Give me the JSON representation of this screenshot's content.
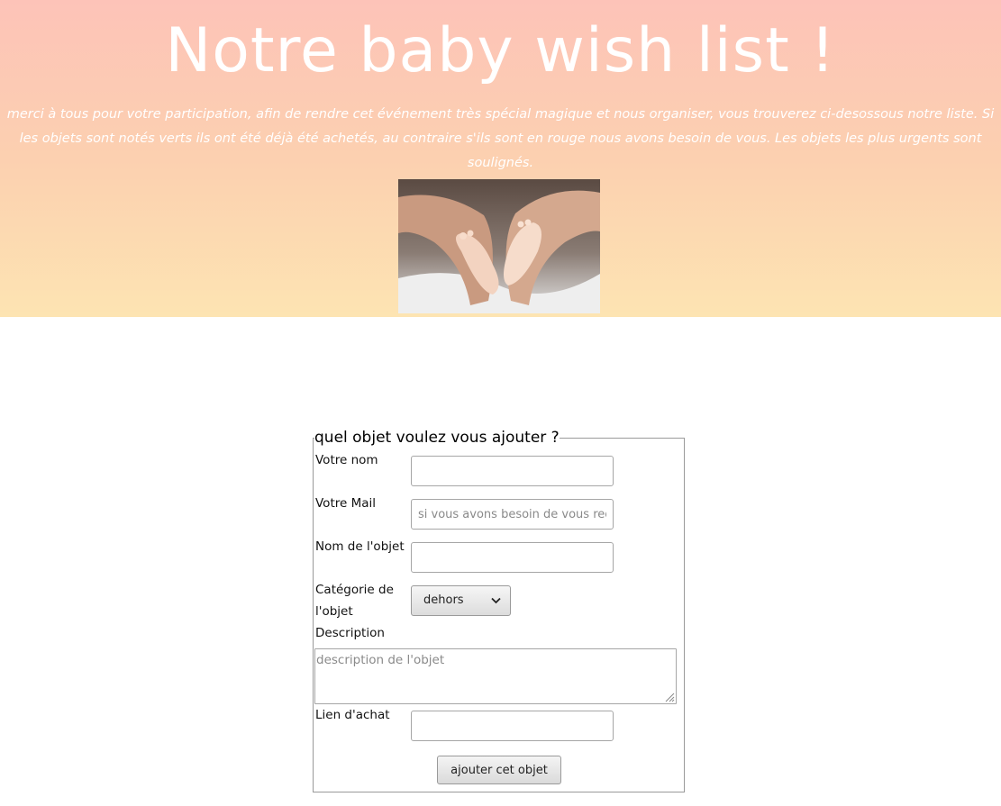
{
  "header": {
    "title": "Notre baby wish list !",
    "subtitle": "merci à tous pour votre participation, afin de rendre cet événement très spécial magique et nous organiser, vous trouverez ci-desossous notre liste. Si les objets sont notés verts ils ont été déjà été achetés, au contraire s'ils sont en rouge nous avons besoin de vous. Les objets les plus urgents sont soulignés."
  },
  "form": {
    "legend": "quel objet voulez vous ajouter ?",
    "name_label": "Votre nom",
    "name_value": "",
    "mail_label": "Votre Mail",
    "mail_placeholder": "si vous avons besoin de vous recontacter",
    "object_label": "Nom de l'objet",
    "object_value": "",
    "category_label": "Catégorie de l'objet",
    "category_selected": "dehors",
    "description_label": "Description",
    "description_placeholder": "description de l'objet",
    "link_label": "Lien d'achat",
    "link_value": "",
    "submit_label": "ajouter cet objet"
  },
  "colors": {
    "header_gradient_top": "#fdc3b8",
    "header_gradient_bottom": "#fde4b2",
    "header_text": "#ffffff"
  },
  "icons": {
    "select_arrow": "chevron-down-icon",
    "textarea_grip": "resize-grip-icon"
  }
}
